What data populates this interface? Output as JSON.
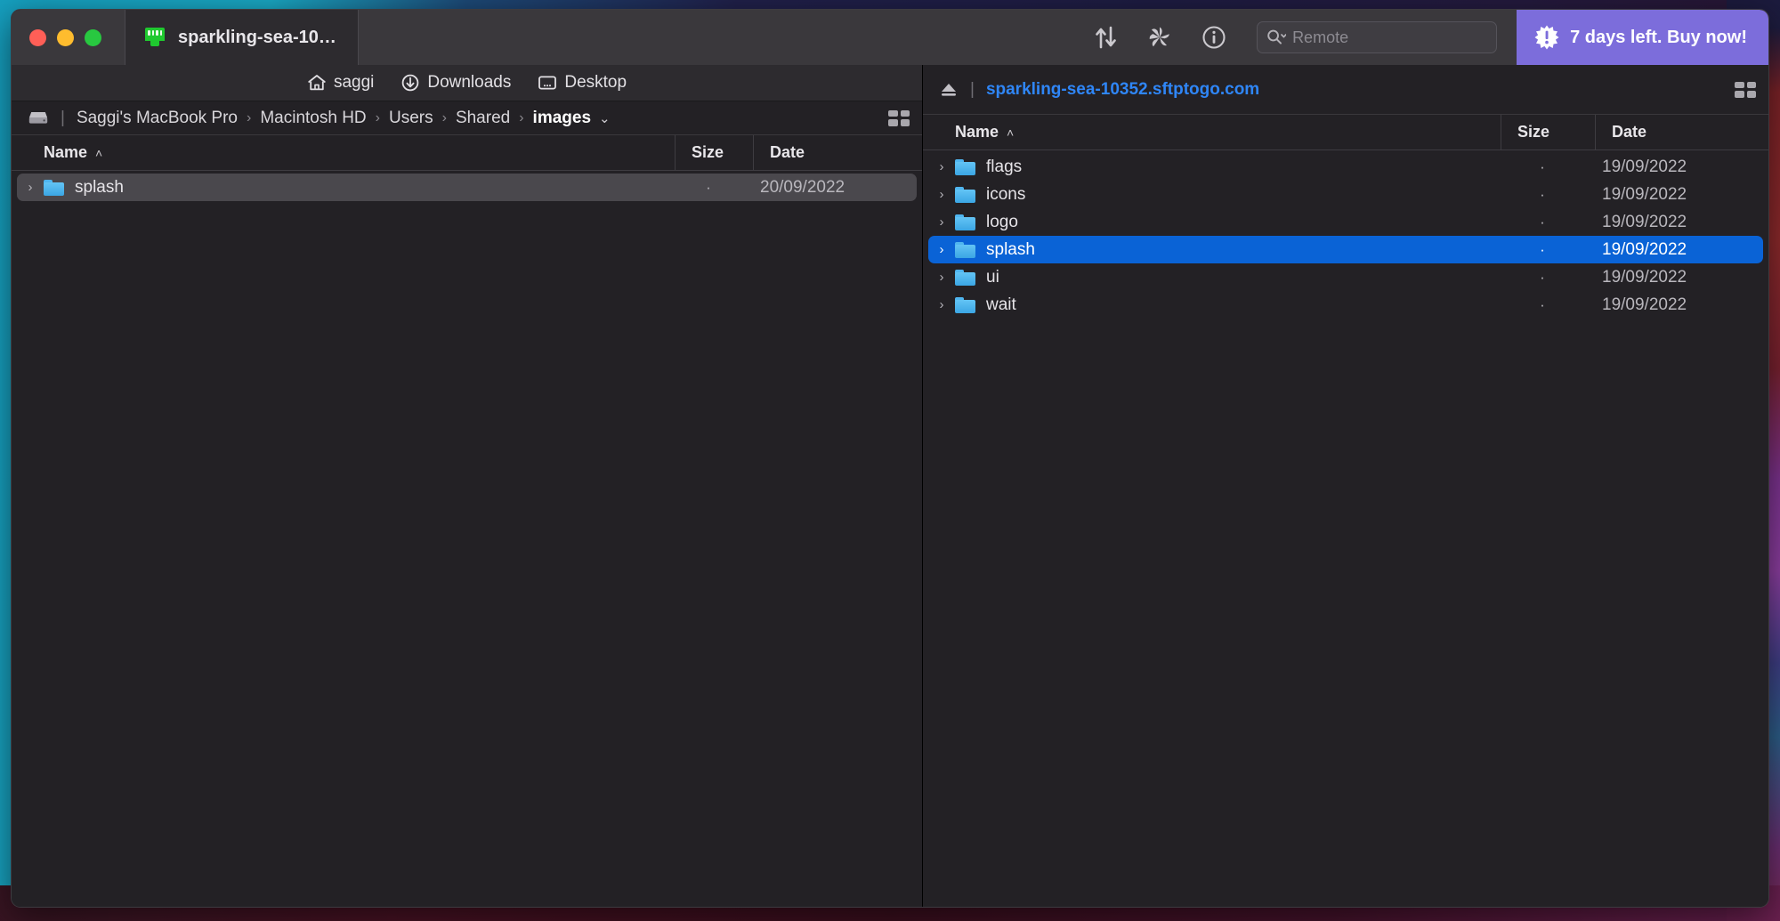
{
  "window": {
    "traffic_lights": [
      "close",
      "minimize",
      "zoom"
    ],
    "tab": {
      "icon": "ethernet-plug-icon",
      "title": "sparkling-sea-10…"
    }
  },
  "toolbar": {
    "icons": [
      {
        "name": "transfer-queue-icon",
        "label": "Transfers"
      },
      {
        "name": "fan-pinwheel-icon",
        "label": "Activity"
      },
      {
        "name": "info-circle-icon",
        "label": "Info"
      }
    ],
    "search": {
      "placeholder": "Remote",
      "value": "",
      "icon": "search-icon"
    },
    "buy_badge": {
      "text": "7 days left. Buy now!",
      "icon": "burst-alert-icon",
      "color": "#7c6ddb"
    }
  },
  "left_pane": {
    "shortcuts": [
      {
        "icon": "home-icon",
        "label": "saggi"
      },
      {
        "icon": "download-icon",
        "label": "Downloads"
      },
      {
        "icon": "desktop-icon",
        "label": "Desktop"
      }
    ],
    "path": {
      "icon": "hard-drive-icon",
      "crumbs": [
        "Saggi's MacBook Pro",
        "Macintosh HD",
        "Users",
        "Shared",
        "images"
      ],
      "separator": "›",
      "chevron": "⌄"
    },
    "columns": {
      "name": "Name",
      "size": "Size",
      "date": "Date",
      "sort_caret": "˄"
    },
    "rows": [
      {
        "disclosure": "›",
        "icon": "folder-icon",
        "name": "splash",
        "size": "·",
        "date": "20/09/2022",
        "selected": "inactive"
      }
    ],
    "grid_view_icon": "grid-view-icon"
  },
  "right_pane": {
    "path": {
      "icon": "eject-icon",
      "host": "sparkling-sea-10352.sftptogo.com"
    },
    "columns": {
      "name": "Name",
      "size": "Size",
      "date": "Date",
      "sort_caret": "˄"
    },
    "rows": [
      {
        "disclosure": "›",
        "icon": "folder-icon",
        "name": "flags",
        "size": "·",
        "date": "19/09/2022",
        "selected": "none"
      },
      {
        "disclosure": "›",
        "icon": "folder-icon",
        "name": "icons",
        "size": "·",
        "date": "19/09/2022",
        "selected": "none"
      },
      {
        "disclosure": "›",
        "icon": "folder-icon",
        "name": "logo",
        "size": "·",
        "date": "19/09/2022",
        "selected": "none"
      },
      {
        "disclosure": "›",
        "icon": "folder-icon",
        "name": "splash",
        "size": "·",
        "date": "19/09/2022",
        "selected": "active"
      },
      {
        "disclosure": "›",
        "icon": "folder-icon",
        "name": "ui",
        "size": "·",
        "date": "19/09/2022",
        "selected": "none"
      },
      {
        "disclosure": "›",
        "icon": "folder-icon",
        "name": "wait",
        "size": "·",
        "date": "19/09/2022",
        "selected": "none"
      }
    ],
    "grid_view_icon": "grid-view-icon"
  },
  "colors": {
    "selection_active": "#0a63d6",
    "selection_inactive": "#4a484d",
    "link": "#2f86f7",
    "accent_badge": "#7c6ddb",
    "window_bg": "#232125",
    "titlebar_bg": "#3a383c"
  }
}
